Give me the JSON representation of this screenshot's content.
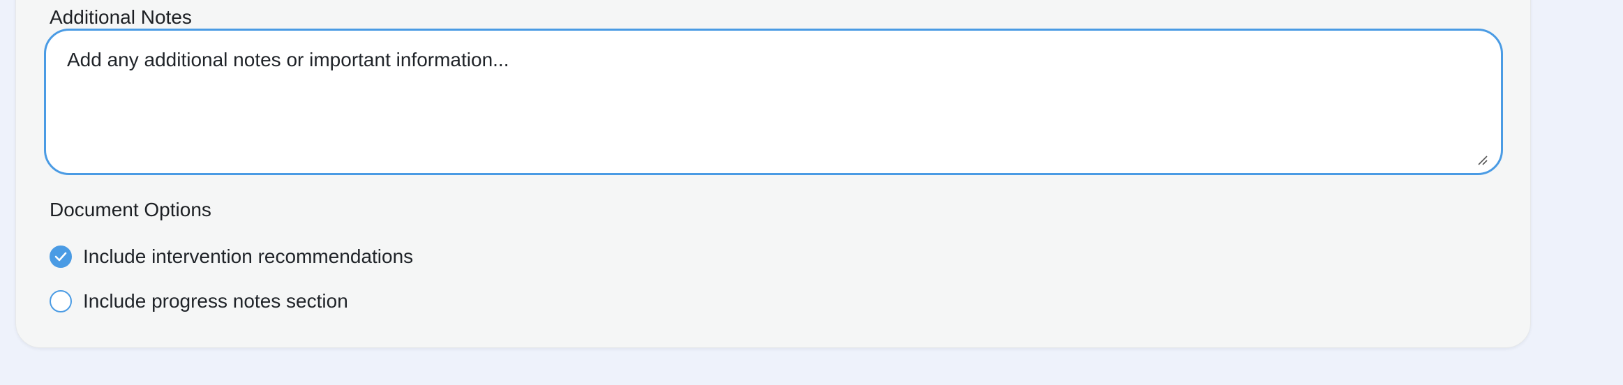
{
  "notes": {
    "label": "Additional Notes",
    "placeholder": "Add any additional notes or important information..."
  },
  "document_options": {
    "title": "Document Options",
    "options": [
      {
        "label": "Include intervention recommendations",
        "checked": true
      },
      {
        "label": "Include progress notes section",
        "checked": false
      }
    ]
  },
  "colors": {
    "accent": "#4a9be4",
    "page_background": "#eef2fb",
    "card_background": "#f5f6f6"
  },
  "icons": {
    "checked": "check-icon",
    "resize": "resize-handle-icon"
  }
}
